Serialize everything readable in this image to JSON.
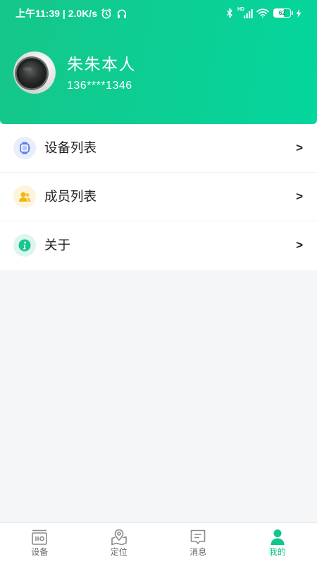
{
  "status_bar": {
    "time_speed": "上午11:39 | 2.0K/s",
    "network_label": "HD",
    "battery_level": "62",
    "icons": [
      "alarm-icon",
      "headphones-icon",
      "bluetooth-icon",
      "signal-icon",
      "wifi-icon",
      "battery-icon",
      "charging-icon"
    ]
  },
  "profile": {
    "name": "朱朱本人",
    "phone": "136****1346"
  },
  "menu": {
    "items": [
      {
        "label": "设备列表",
        "arrow": ">",
        "icon": "watch-icon",
        "icon_color": "#5b7ff2",
        "icon_bg": "#e9eefc"
      },
      {
        "label": "成员列表",
        "arrow": ">",
        "icon": "members-icon",
        "icon_color": "#f3b50c",
        "icon_bg": "#fdf4dd"
      },
      {
        "label": "关于",
        "arrow": ">",
        "icon": "info-icon",
        "icon_color": "#17c58f",
        "icon_bg": "#ddf5ee"
      }
    ]
  },
  "tabbar": {
    "tabs": [
      {
        "label": "设备",
        "icon": "device-icon",
        "active": false
      },
      {
        "label": "定位",
        "icon": "location-icon",
        "active": false
      },
      {
        "label": "消息",
        "icon": "message-icon",
        "active": false
      },
      {
        "label": "我的",
        "icon": "profile-icon",
        "active": true
      }
    ]
  },
  "colors": {
    "header_start": "#16c68a",
    "header_end": "#04d69d",
    "accent": "#12c48d",
    "background": "#f5f6f8",
    "tab_inactive": "#8a8a8a"
  }
}
